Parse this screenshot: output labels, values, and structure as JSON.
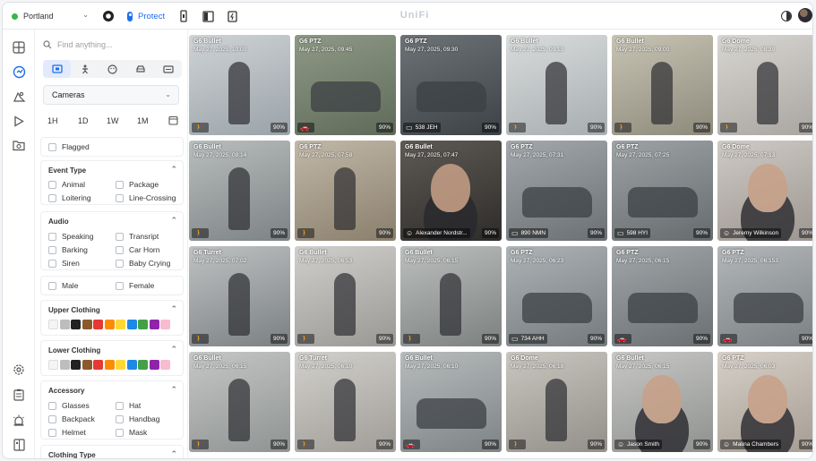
{
  "topbar": {
    "site": "Portland",
    "app_tab": "Protect",
    "brand": "UniFi"
  },
  "filters": {
    "search_placeholder": "Find anything...",
    "source_select": "Cameras",
    "ranges": [
      "1H",
      "1D",
      "1W",
      "1M"
    ],
    "flagged": "Flagged",
    "event_type": {
      "title": "Event Type",
      "options": [
        "Animal",
        "Package",
        "Loitering",
        "Line-Crossing"
      ]
    },
    "audio": {
      "title": "Audio",
      "options": [
        "Speaking",
        "Transript",
        "Barking",
        "Car Horn",
        "Siren",
        "Baby Crying"
      ]
    },
    "gender": [
      "Male",
      "Female"
    ],
    "upper_clothing": {
      "title": "Upper Clothing",
      "colors": [
        "#f5f5f5",
        "#bdbdbd",
        "#222222",
        "#8b5a2b",
        "#e53935",
        "#fb8c00",
        "#fdd835",
        "#1e88e5",
        "#43a047",
        "#8e24aa",
        "#f8bbd0"
      ]
    },
    "lower_clothing": {
      "title": "Lower Clothing",
      "colors": [
        "#f5f5f5",
        "#bdbdbd",
        "#222222",
        "#8b5a2b",
        "#e53935",
        "#fb8c00",
        "#fdd835",
        "#1e88e5",
        "#43a047",
        "#8e24aa",
        "#f8bbd0"
      ]
    },
    "accessory": {
      "title": "Accessory",
      "options": [
        "Glasses",
        "Hat",
        "Backpack",
        "Handbag",
        "Helmet",
        "Mask"
      ]
    },
    "clothing_type": {
      "title": "Clothing Type"
    }
  },
  "events": [
    {
      "camera": "G6 Bullet",
      "time": "May 27, 2025, 10:00",
      "type": "person",
      "label": "",
      "confidence": "90%"
    },
    {
      "camera": "G6 PTZ",
      "time": "May 27, 2025, 09:45",
      "type": "vehicle",
      "label": "",
      "confidence": "90%"
    },
    {
      "camera": "G6 PTZ",
      "time": "May 27, 2025, 09:30",
      "type": "plate",
      "label": "538 JEH",
      "confidence": "90%"
    },
    {
      "camera": "G6 Bullet",
      "time": "May 27, 2025, 09:15",
      "type": "person",
      "label": "",
      "confidence": "90%"
    },
    {
      "camera": "G6 Bullet",
      "time": "May 27, 2025, 09:00",
      "type": "person",
      "label": "",
      "confidence": "90%"
    },
    {
      "camera": "G6 Dome",
      "time": "May 27, 2025, 08:39",
      "type": "person",
      "label": "",
      "confidence": "90%"
    },
    {
      "camera": "G6 Bullet",
      "time": "May 27, 2025, 08:14",
      "type": "person",
      "label": "",
      "confidence": "90%"
    },
    {
      "camera": "G6 PTZ",
      "time": "May 27, 2025, 07:58",
      "type": "person",
      "label": "",
      "confidence": "90%"
    },
    {
      "camera": "G6 Bullet",
      "time": "May 27, 2025, 07:47",
      "type": "face",
      "label": "Alexander Nordstr...",
      "confidence": "90%"
    },
    {
      "camera": "G6 PTZ",
      "time": "May 27, 2025, 07:31",
      "type": "plate",
      "label": "890 NMN",
      "confidence": "90%"
    },
    {
      "camera": "G6 PTZ",
      "time": "May 27, 2025, 07:25",
      "type": "plate",
      "label": "598 HYI",
      "confidence": "90%"
    },
    {
      "camera": "G6 Dome",
      "time": "May 27, 2025, 07:13",
      "type": "face",
      "label": "Jeremy Wilkinson",
      "confidence": "90%"
    },
    {
      "camera": "G6 Turret",
      "time": "May 27, 2025, 07:02",
      "type": "person",
      "label": "",
      "confidence": "90%"
    },
    {
      "camera": "G6 Bullet",
      "time": "May 27, 2025, 06:53",
      "type": "person",
      "label": "",
      "confidence": "90%"
    },
    {
      "camera": "G6 Bullet",
      "time": "May 27, 2025, 06:15",
      "type": "person",
      "label": "",
      "confidence": "90%"
    },
    {
      "camera": "G6 PTZ",
      "time": "May 27, 2025, 06:23",
      "type": "plate",
      "label": "734 AHH",
      "confidence": "90%"
    },
    {
      "camera": "G6 PTZ",
      "time": "May 27, 2025, 06:15",
      "type": "vehicle",
      "label": "",
      "confidence": "90%"
    },
    {
      "camera": "G6 PTZ",
      "time": "May 27, 2025, 06:153",
      "type": "vehicle",
      "label": "",
      "confidence": "90%"
    },
    {
      "camera": "G6 Bullet",
      "time": "May 27, 2025, 06:15",
      "type": "person",
      "label": "",
      "confidence": "90%"
    },
    {
      "camera": "G6 Turret",
      "time": "May 27, 2025, 06:10",
      "type": "person",
      "label": "",
      "confidence": "90%"
    },
    {
      "camera": "G6 Bullet",
      "time": "May 27, 2025, 06:10",
      "type": "vehicle",
      "label": "",
      "confidence": "90%"
    },
    {
      "camera": "G6 Dome",
      "time": "May 27, 2025, 06:18",
      "type": "person",
      "label": "",
      "confidence": "90%"
    },
    {
      "camera": "G6 Bullet",
      "time": "May 27, 2025, 06:15",
      "type": "face",
      "label": "Jason Smith",
      "confidence": "90%"
    },
    {
      "camera": "G6 PTZ",
      "time": "May 27, 2025, 06:03",
      "type": "face",
      "label": "Malina Chambers",
      "confidence": "90%"
    }
  ]
}
